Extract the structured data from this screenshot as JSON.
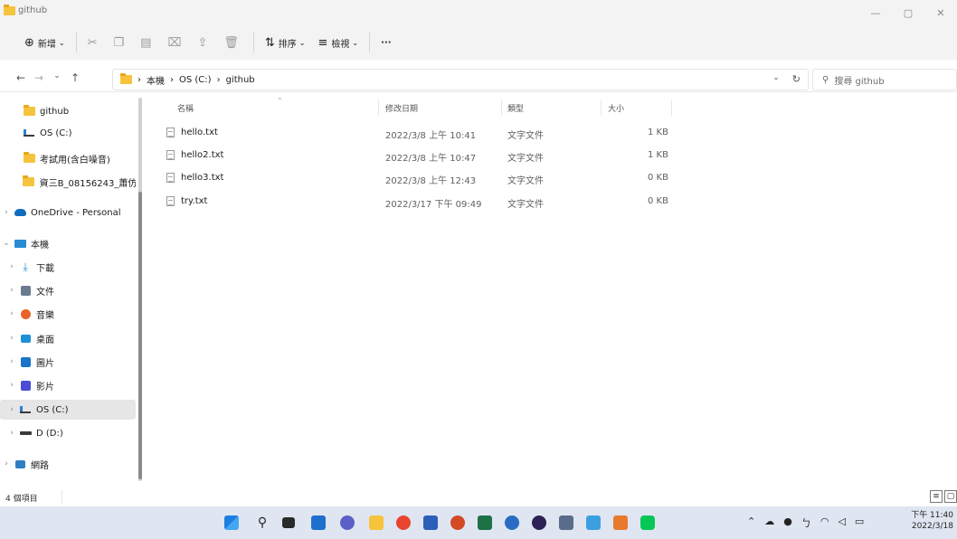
{
  "window": {
    "title": "github",
    "controls": [
      "—",
      "▢",
      "✕"
    ]
  },
  "toolbar": {
    "new_label": "新增",
    "sort_label": "排序",
    "view_label": "檢視",
    "more_label": "···"
  },
  "address": {
    "crumb_pc": "本機",
    "crumb_drive": "OS (C:)",
    "crumb_folder": "github",
    "search_placeholder": "搜尋 github"
  },
  "sidebar": {
    "items": [
      {
        "label": "github"
      },
      {
        "label": "OS (C:)"
      },
      {
        "label": "考試用(含白噪音)"
      },
      {
        "label": "資三B_08156243_蕭仿"
      },
      {
        "label": "OneDrive - Personal"
      },
      {
        "label": "本機"
      },
      {
        "label": "下載"
      },
      {
        "label": "文件"
      },
      {
        "label": "音樂"
      },
      {
        "label": "桌面"
      },
      {
        "label": "圖片"
      },
      {
        "label": "影片"
      },
      {
        "label": "OS (C:)"
      },
      {
        "label": "D (D:)"
      },
      {
        "label": "網路"
      }
    ]
  },
  "file_list": {
    "columns": {
      "name": "名稱",
      "modified": "修改日期",
      "type": "類型",
      "size": "大小"
    },
    "rows": [
      {
        "name": "hello.txt",
        "modified": "2022/3/8 上午 10:41",
        "type": "文字文件",
        "size": "1 KB"
      },
      {
        "name": "hello2.txt",
        "modified": "2022/3/8 上午 10:47",
        "type": "文字文件",
        "size": "1 KB"
      },
      {
        "name": "hello3.txt",
        "modified": "2022/3/8 上午 12:43",
        "type": "文字文件",
        "size": "0 KB"
      },
      {
        "name": "try.txt",
        "modified": "2022/3/17 下午 09:49",
        "type": "文字文件",
        "size": "0 KB"
      }
    ]
  },
  "status": {
    "item_count": "4 個項目"
  },
  "taskbar": {
    "time": "下午 11:40",
    "date": "2022/3/18"
  }
}
